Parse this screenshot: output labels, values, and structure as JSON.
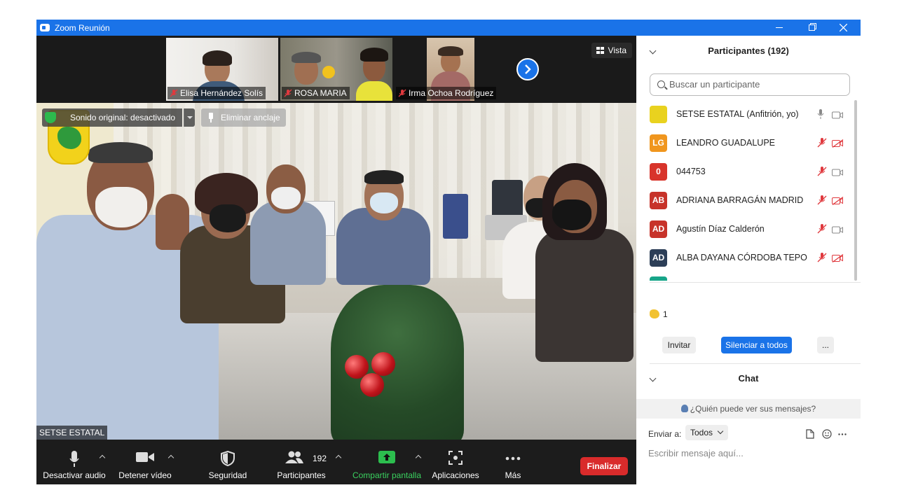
{
  "window": {
    "title": "Zoom Reunión"
  },
  "thumbnails": [
    {
      "name": "Elisa Hernández Solís"
    },
    {
      "name": "ROSA MARIA"
    },
    {
      "name": "Irma Ochoa Rodríguez"
    }
  ],
  "view_button": "Vista",
  "main_video": {
    "original_sound": "Sonido original: desactivado",
    "unpin": "Eliminar anclaje",
    "speaker": "SETSE ESTATAL"
  },
  "toolbar": {
    "mute": "Desactivar audio",
    "stop_video": "Detener vídeo",
    "security": "Seguridad",
    "participants": "Participantes",
    "participants_count": "192",
    "share": "Compartir pantalla",
    "apps": "Aplicaciones",
    "more": "Más",
    "end": "Finalizar"
  },
  "participants_panel": {
    "title": "Participantes (192)",
    "search_placeholder": "Buscar un participante",
    "list": [
      {
        "initials": "",
        "name": "SETSE ESTATAL (Anfitrión, yo)",
        "color": "#e9d21f",
        "mic": "on",
        "cam": "on"
      },
      {
        "initials": "LG",
        "name": " LEANDRO GUADALUPE",
        "color": "#f0961e",
        "mic": "muted",
        "cam": "off"
      },
      {
        "initials": "0",
        "name": "044753",
        "color": "#d8342b",
        "mic": "muted",
        "cam": "on"
      },
      {
        "initials": "AB",
        "name": "ADRIANA BARRAGÁN MADRID",
        "color": "#c7332a",
        "mic": "muted",
        "cam": "off"
      },
      {
        "initials": "AD",
        "name": "Agustín Díaz Calderón",
        "color": "#c7332a",
        "mic": "muted",
        "cam": "on"
      },
      {
        "initials": "AD",
        "name": "ALBA DAYANA CÓRDOBA TEPO",
        "color": "#2c3e57",
        "mic": "muted",
        "cam": "off"
      }
    ],
    "reaction_count": "1",
    "invite": "Invitar",
    "mute_all": "Silenciar a todos",
    "more": "..."
  },
  "chat": {
    "title": "Chat",
    "who_can_see": "¿Quién puede ver sus mensajes?",
    "send_to_label": "Enviar a:",
    "send_to_value": "Todos",
    "input_placeholder": "Escribir mensaje aquí..."
  }
}
